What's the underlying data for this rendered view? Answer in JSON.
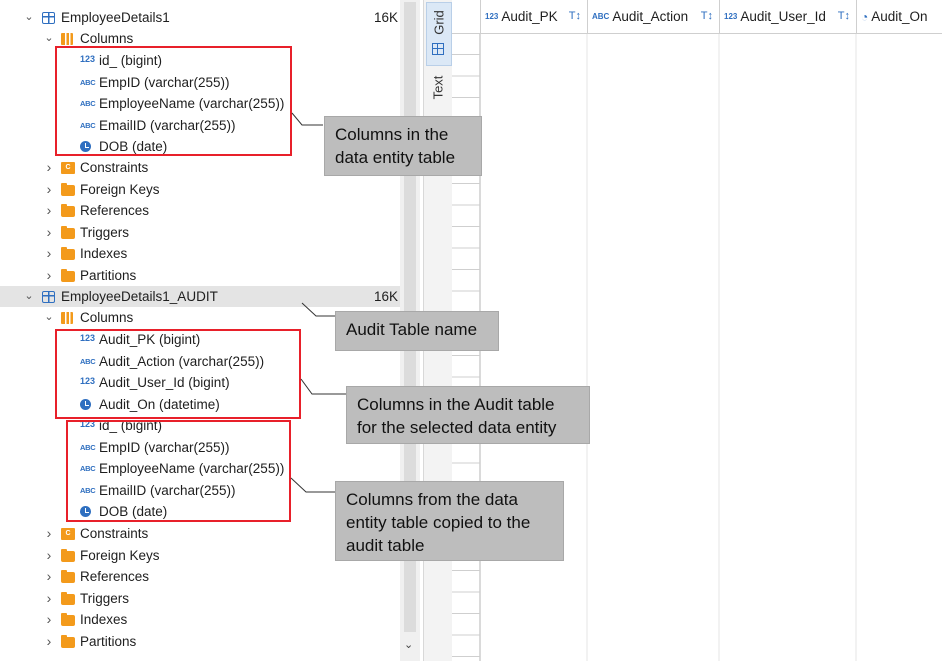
{
  "tree": {
    "table1": {
      "name": "EmployeeDetails1",
      "size": "16K",
      "columns_label": "Columns",
      "columns": [
        {
          "icon": "123",
          "label": "id_ (bigint)"
        },
        {
          "icon": "abc",
          "label": "EmpID (varchar(255))"
        },
        {
          "icon": "abc",
          "label": "EmployeeName (varchar(255))"
        },
        {
          "icon": "abc",
          "label": "EmailID (varchar(255))"
        },
        {
          "icon": "clock",
          "label": "DOB (date)"
        }
      ],
      "groups": [
        "Constraints",
        "Foreign Keys",
        "References",
        "Triggers",
        "Indexes",
        "Partitions"
      ]
    },
    "table2": {
      "name": "EmployeeDetails1_AUDIT",
      "size": "16K",
      "columns_label": "Columns",
      "columns": [
        {
          "icon": "123",
          "label": "Audit_PK (bigint)"
        },
        {
          "icon": "abc",
          "label": "Audit_Action (varchar(255))"
        },
        {
          "icon": "123",
          "label": "Audit_User_Id (bigint)"
        },
        {
          "icon": "clock",
          "label": "Audit_On (datetime)"
        },
        {
          "icon": "123",
          "label": "id_ (bigint)"
        },
        {
          "icon": "abc",
          "label": "EmpID (varchar(255))"
        },
        {
          "icon": "abc",
          "label": "EmployeeName (varchar(255))"
        },
        {
          "icon": "abc",
          "label": "EmailID (varchar(255))"
        },
        {
          "icon": "clock",
          "label": "DOB (date)"
        }
      ],
      "groups": [
        "Constraints",
        "Foreign Keys",
        "References",
        "Triggers",
        "Indexes",
        "Partitions"
      ]
    }
  },
  "vtabs": {
    "grid": "Grid",
    "text": "Text"
  },
  "grid": {
    "columns": [
      {
        "icon": "123",
        "label": "Audit_PK"
      },
      {
        "icon": "abc",
        "label": "Audit_Action"
      },
      {
        "icon": "123",
        "label": "Audit_User_Id"
      },
      {
        "icon": "clock",
        "label": "Audit_On"
      }
    ]
  },
  "annotations": {
    "entity_columns": [
      "Columns in the",
      "data entity table"
    ],
    "audit_table_name": [
      "Audit Table name"
    ],
    "audit_columns": [
      "Columns in the Audit table",
      "for the selected data entity"
    ],
    "copied_columns": [
      "Columns from the data",
      "entity table copied to the",
      "audit table"
    ]
  },
  "colors": {
    "annotation_box": "#e8202a",
    "callout_bg": "#bdbdbd",
    "icon_blue": "#2f6fc0",
    "folder_orange": "#f39a1b"
  }
}
